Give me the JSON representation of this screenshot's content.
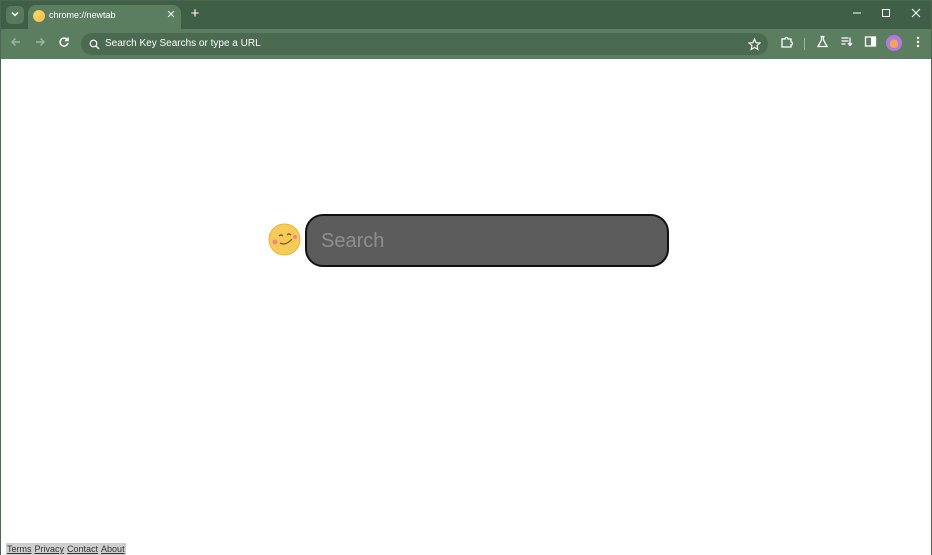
{
  "tab": {
    "title": "chrome://newtab",
    "close_glyph": "✕",
    "new_tab_glyph": "+"
  },
  "omnibox": {
    "placeholder": "Search Key Searchs or type a URL"
  },
  "page": {
    "search_placeholder": "Search",
    "footer_links": [
      "Terms",
      "Privacy",
      "Contact",
      "About"
    ]
  },
  "colors": {
    "frame": "#3f5f46",
    "toolbar": "#5b7e61",
    "omnibox": "#4a6b50",
    "search_box": "#5c5c5c"
  },
  "icons": [
    "tab-search-icon",
    "back-icon",
    "forward-icon",
    "reload-icon",
    "search-icon",
    "star-icon",
    "extensions-icon",
    "labs-icon",
    "reading-list-icon",
    "side-panel-icon",
    "menu-icon",
    "minimize-icon",
    "maximize-icon",
    "close-icon"
  ]
}
